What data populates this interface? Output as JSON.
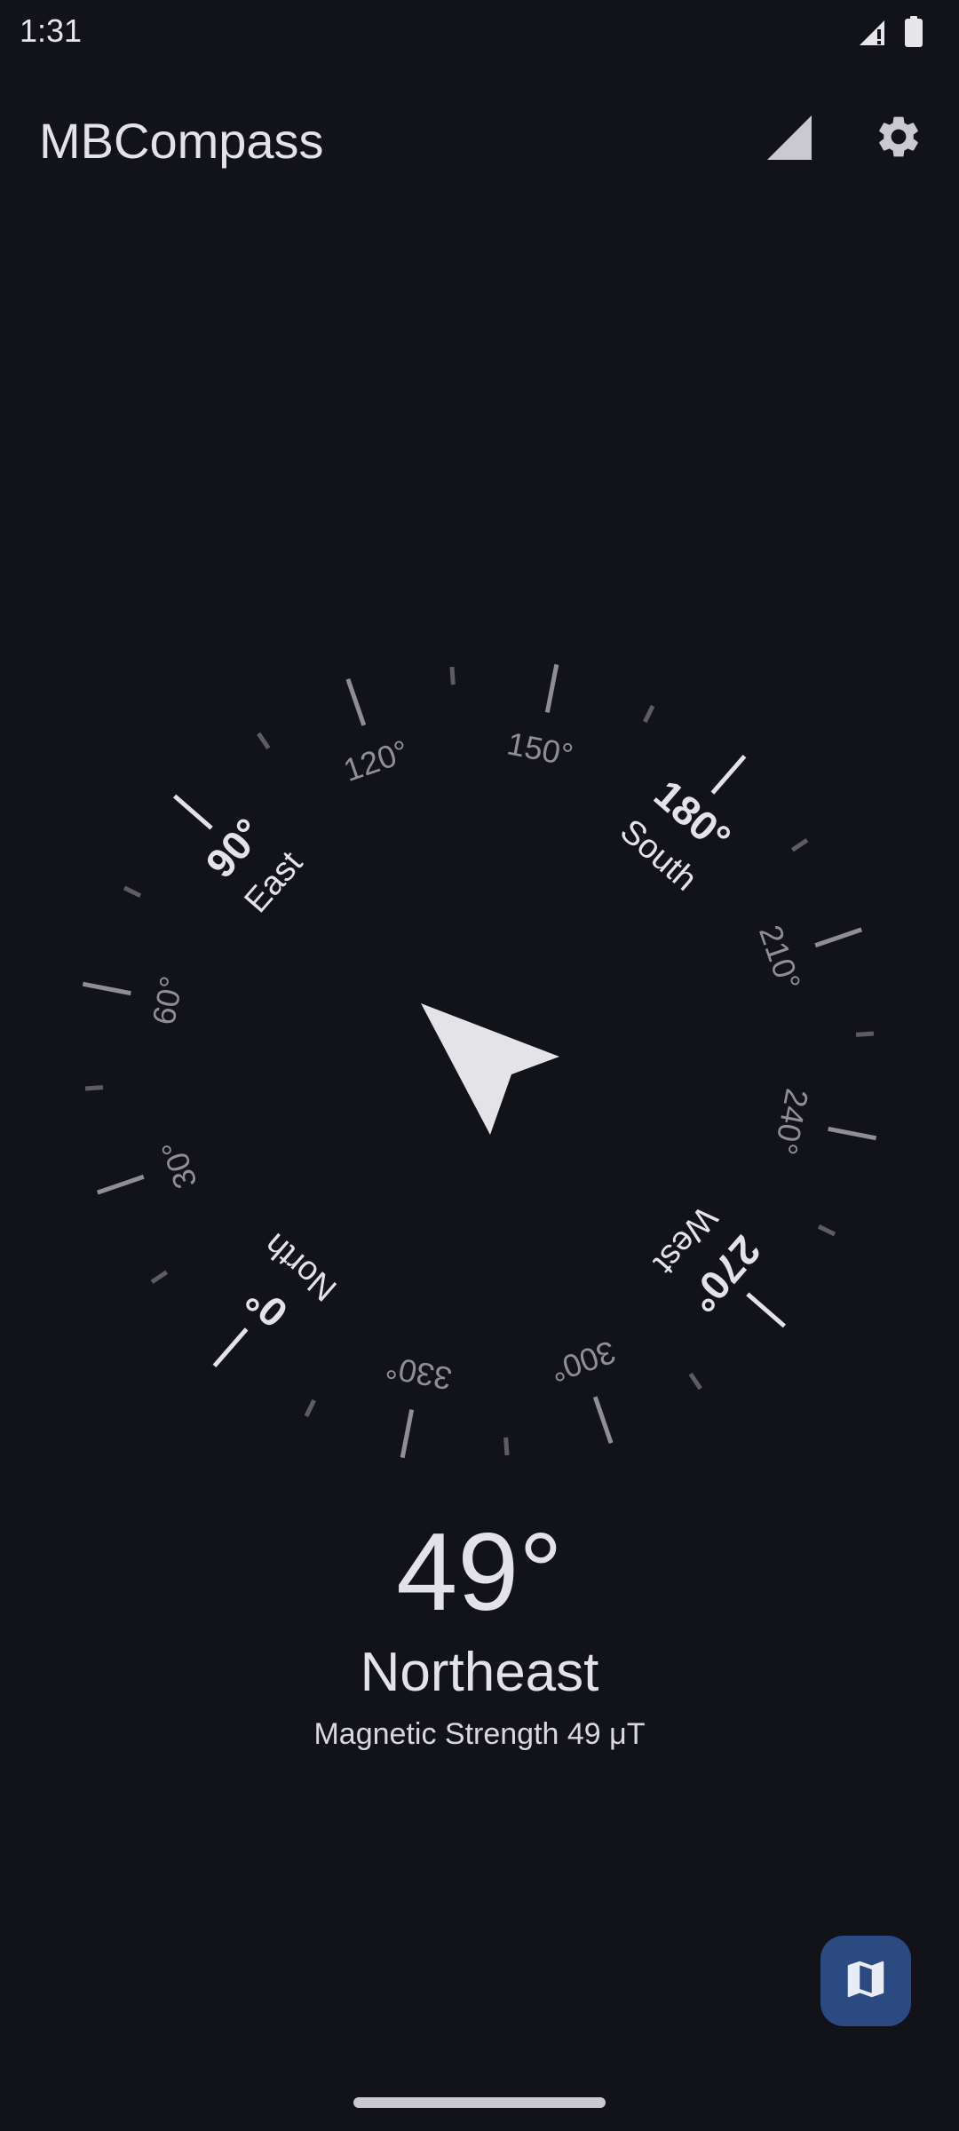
{
  "status_bar": {
    "time": "1:31",
    "icons": [
      "signal-icon",
      "battery-icon"
    ]
  },
  "app_bar": {
    "title": "MBCompass",
    "actions": [
      "signal-triangle-icon",
      "settings-gear-icon"
    ]
  },
  "compass": {
    "heading_value": 49,
    "cardinal_labels": [
      {
        "deg": 0,
        "degree_text": "0°",
        "name": "North"
      },
      {
        "deg": 90,
        "degree_text": "90°",
        "name": "East"
      },
      {
        "deg": 180,
        "degree_text": "180°",
        "name": "South"
      },
      {
        "deg": 270,
        "degree_text": "270°",
        "name": "West"
      }
    ],
    "minor_labels": [
      {
        "deg": 30,
        "text": "30°"
      },
      {
        "deg": 60,
        "text": "60°"
      },
      {
        "deg": 120,
        "text": "120°"
      },
      {
        "deg": 150,
        "text": "150°"
      },
      {
        "deg": 210,
        "text": "210°"
      },
      {
        "deg": 240,
        "text": "240°"
      },
      {
        "deg": 300,
        "text": "300°"
      },
      {
        "deg": 330,
        "text": "330°"
      }
    ],
    "arrow_icon": "navigation-arrow-icon"
  },
  "readout": {
    "degrees": "49°",
    "direction": "Northeast",
    "magnetic_strength": "Magnetic Strength 49 μT"
  },
  "fab": {
    "icon": "map-icon"
  },
  "colors": {
    "background": "#121318",
    "text_primary": "#e3e2e9",
    "text_secondary": "#8e8e94",
    "fab_background": "#2b4a82"
  }
}
